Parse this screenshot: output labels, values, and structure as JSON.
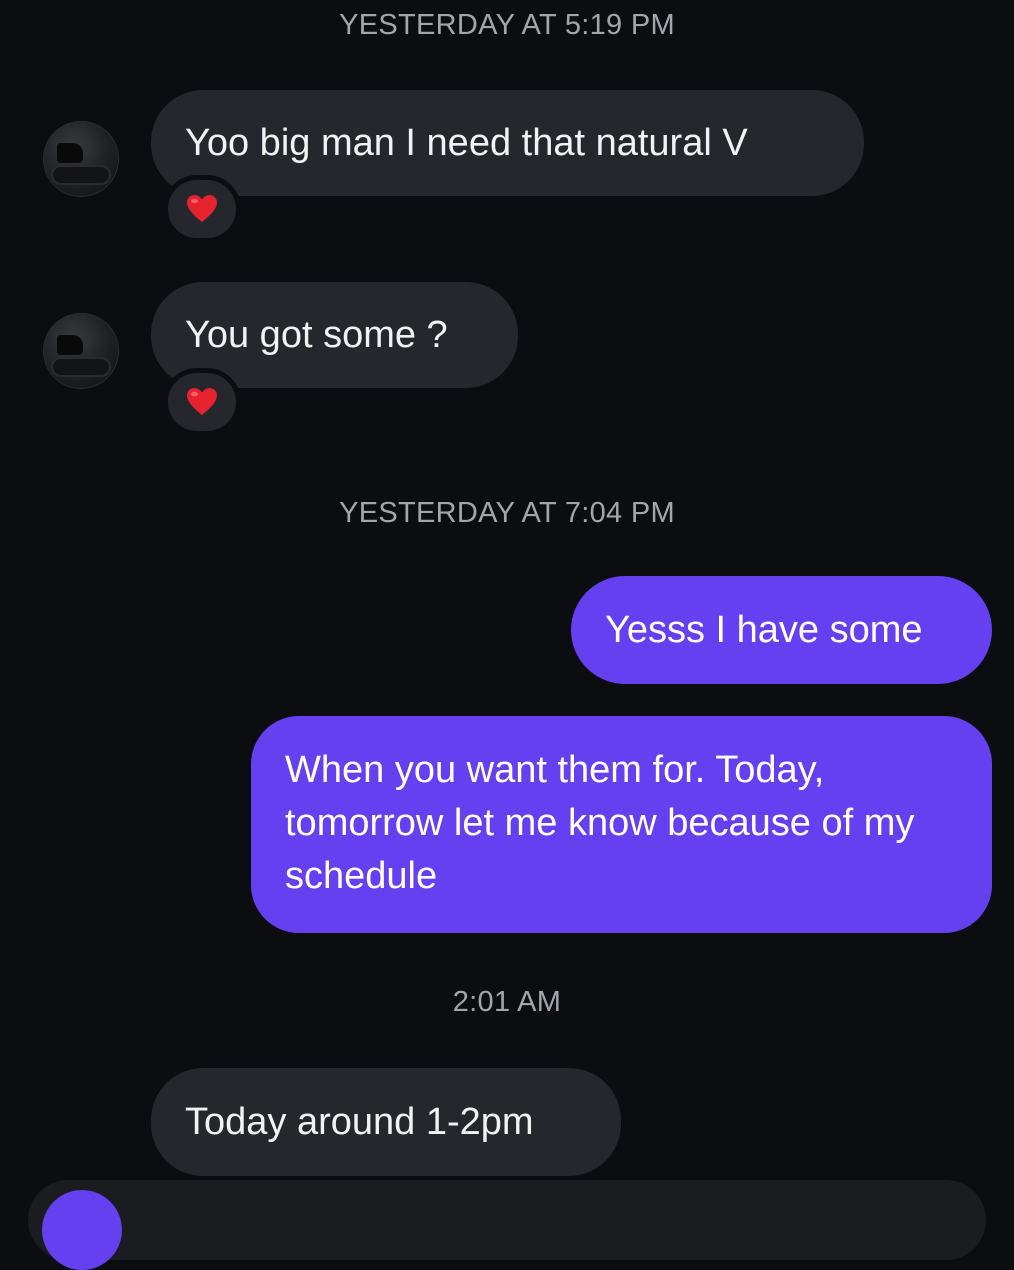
{
  "conversation": {
    "timestamps": [
      "YESTERDAY AT 5:19 PM",
      "YESTERDAY AT 7:04 PM",
      "2:01 AM"
    ],
    "messages": [
      {
        "sender": "them",
        "text": "Yoo big man I need that natural V",
        "reaction": "red-heart"
      },
      {
        "sender": "them",
        "text": "You got some ?",
        "reaction": "red-heart"
      },
      {
        "sender": "me",
        "text": "Yesss I have some"
      },
      {
        "sender": "me",
        "text": "When you want them for. Today, tomorrow let me know because of my schedule"
      },
      {
        "sender": "them",
        "text": "Today around 1-2pm"
      }
    ]
  },
  "colors": {
    "background": "#0c0d11",
    "incoming_bubble": "#25272c",
    "outgoing_bubble": "#6440f0",
    "timestamp_text": "#a3a5ab",
    "heart": "#e5222d"
  },
  "icons": {
    "reaction": "red-heart-icon",
    "avatar": "contact-avatar"
  }
}
